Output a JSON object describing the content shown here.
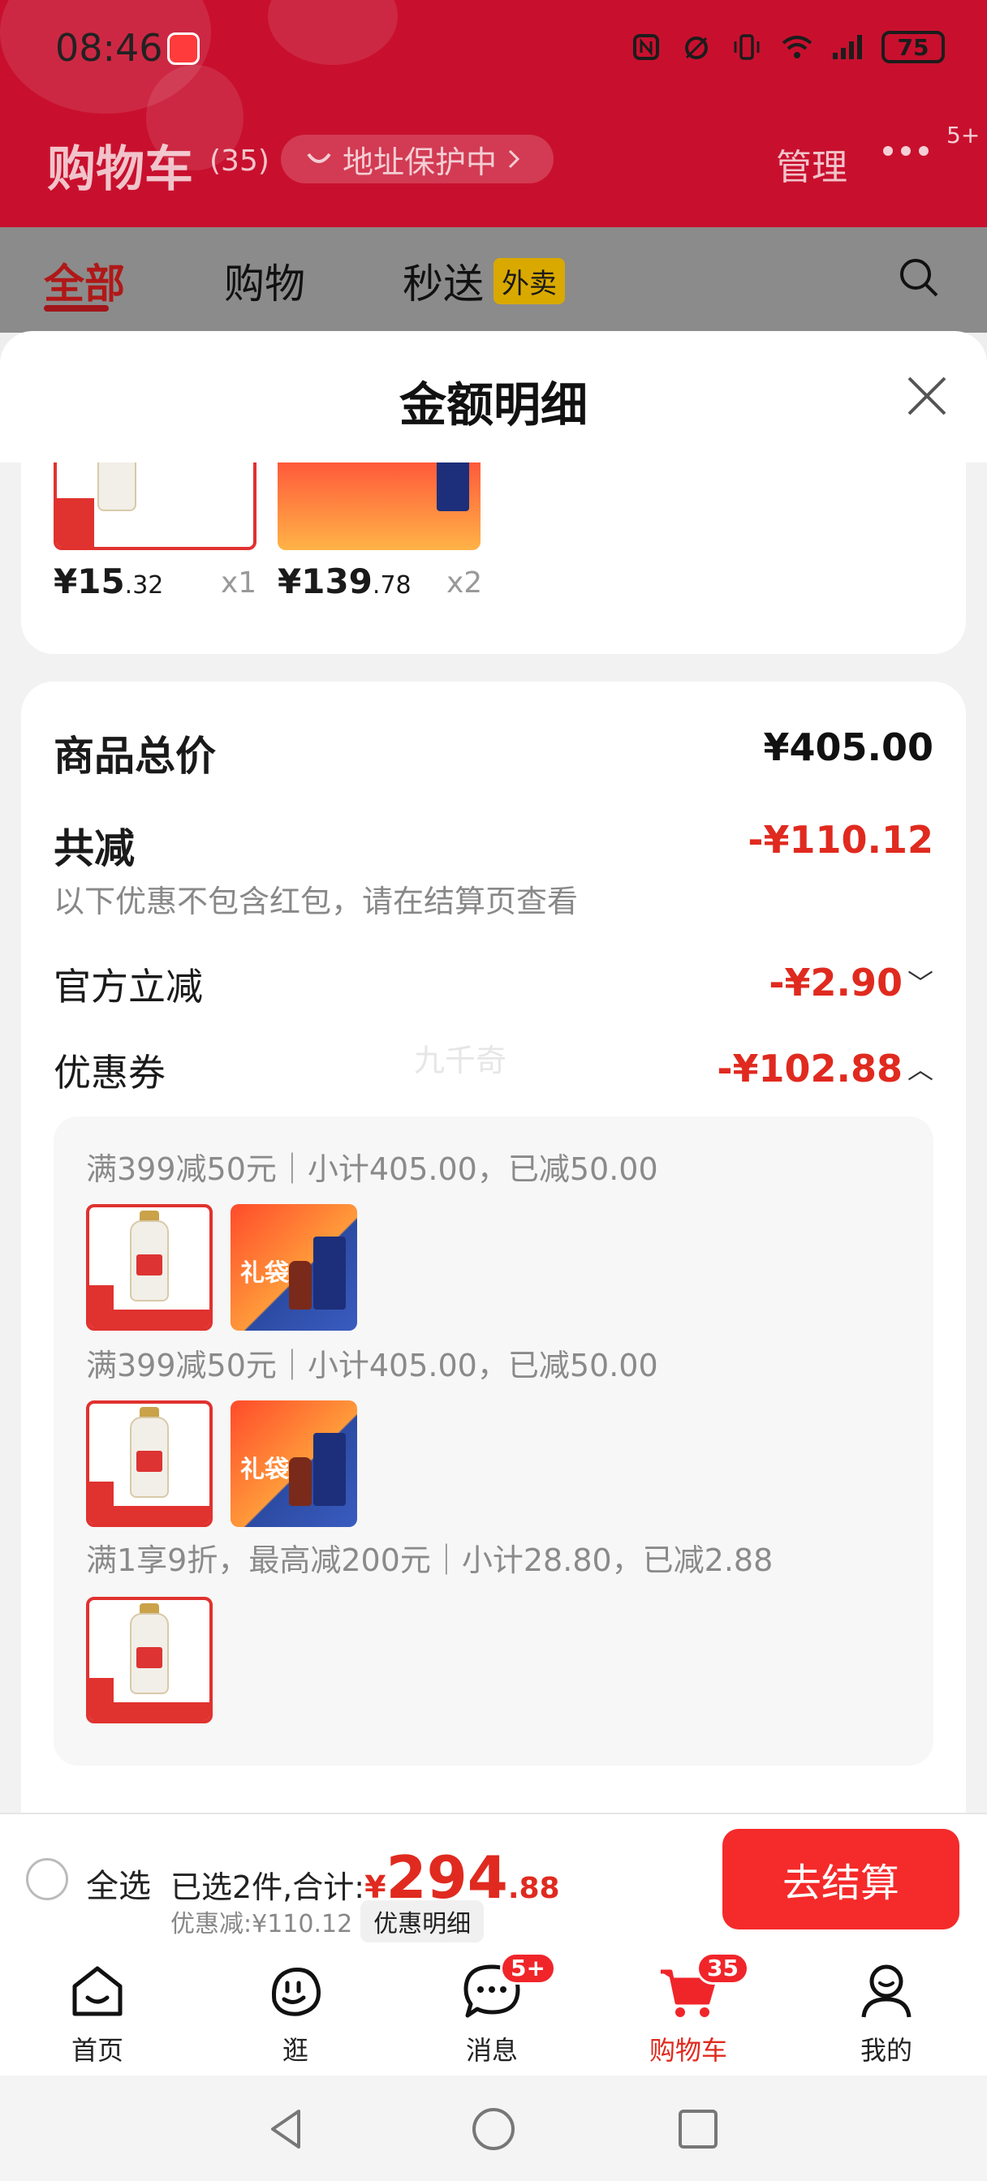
{
  "status_bar": {
    "time": "08:46",
    "battery": "75"
  },
  "header": {
    "title": "购物车",
    "count": "(35)",
    "address_pill": "地址保护中",
    "manage": "管理",
    "more_badge": "5+"
  },
  "tabs": {
    "items": [
      "全部",
      "购物",
      "秒送"
    ],
    "waimai_tag": "外卖"
  },
  "sheet": {
    "title": "金额明细",
    "products": [
      {
        "price_int": "¥15",
        "price_dec": ".32",
        "qty": "x1"
      },
      {
        "price_int": "¥139",
        "price_dec": ".78",
        "qty": "x2"
      }
    ],
    "summary": {
      "total_label": "商品总价",
      "total_value": "¥405.00",
      "reduce_label": "共减",
      "reduce_value": "-¥110.12",
      "reduce_note": "以下优惠不包含红包，请在结算页查看",
      "official_label": "官方立减",
      "official_value": "-¥2.90",
      "coupon_label": "优惠券",
      "coupon_value": "-¥102.88",
      "watermark": "九千奇"
    },
    "coupons": [
      "满399减50元｜小计405.00，已减50.00",
      "满399减50元｜小计405.00，已减50.00",
      "满1享9折，最高减200元｜小计28.80，已减2.88"
    ],
    "gift_text": "礼袋"
  },
  "checkout": {
    "select_all": "全选",
    "selected_text": "已选2件,合计:",
    "currency": "¥",
    "total_int": "294",
    "total_dec": ".88",
    "discount_text": "优惠减:¥110.12",
    "detail_chip": "优惠明细",
    "button": "去结算"
  },
  "bottom_nav": {
    "items": [
      "首页",
      "逛",
      "消息",
      "购物车",
      "我的"
    ],
    "message_badge": "5+",
    "cart_badge": "35"
  },
  "colors": {
    "brand_red": "#c8102e",
    "price_red": "#e02a1f",
    "checkout_red": "#f52a2a"
  }
}
